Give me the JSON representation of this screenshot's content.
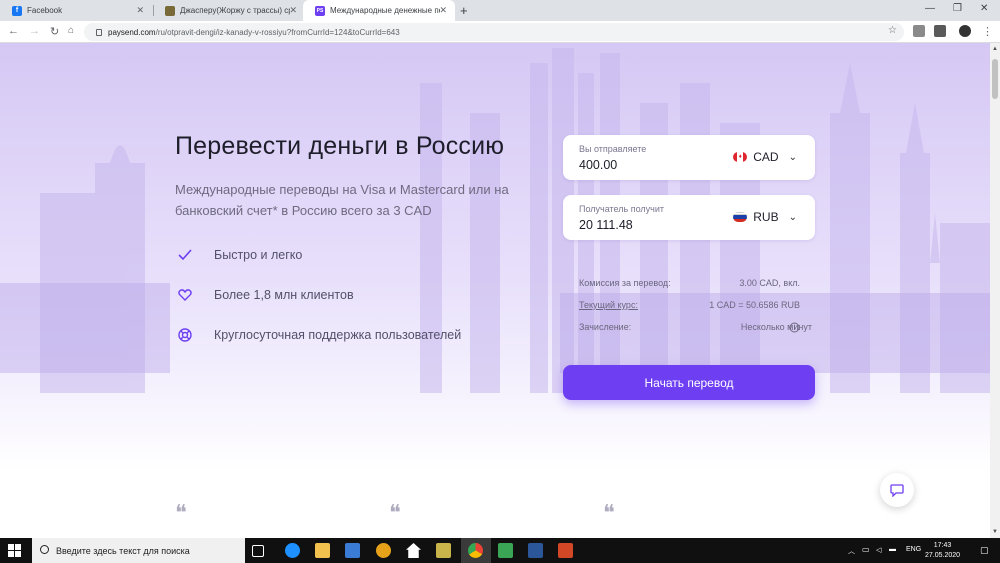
{
  "browser": {
    "tabs": [
      {
        "title": "Facebook",
        "favicon": "facebook-icon",
        "color": "#1877f2"
      },
      {
        "title": "Джасперу(Жоржу с трассы) сро",
        "favicon": "game-icon",
        "color": "#7a6a3a"
      },
      {
        "title": "Международные денежные пер",
        "favicon": "paysend-icon",
        "color": "#6e3ff2",
        "active": true
      }
    ],
    "url_domain": "paysend.com",
    "url_path": "/ru/otpravit-dengi/iz-kanady-v-rossiyu?fromCurrId=124&toCurrId=643"
  },
  "page": {
    "title": "Перевести деньги в Россию",
    "subtitle": "Международные переводы на Visa и Mastercard или на банковский счет* в Россию всего за 3 CAD",
    "features": [
      {
        "icon": "check-icon",
        "text": "Быстро и легко"
      },
      {
        "icon": "heart-icon",
        "text": "Более 1,8 млн клиентов"
      },
      {
        "icon": "lifebuoy-icon",
        "text": "Круглосуточная поддержка пользователей"
      }
    ],
    "accent": "#6e3ff2"
  },
  "calculator": {
    "send": {
      "label": "Вы отправляете",
      "value": "400.00",
      "currency": "CAD"
    },
    "receive": {
      "label": "Получатель получит",
      "value": "20 111.48",
      "currency": "RUB"
    },
    "fee_label": "Комиссия за перевод:",
    "fee_value": "3.00 CAD, вкл.",
    "rate_label": "Текущий курс:",
    "rate_value": "1 CAD = 50.6586 RUB",
    "credit_label": "Зачисление:",
    "credit_value": "Несколько минут",
    "cta": "Начать перевод"
  },
  "quote_mark": "❝",
  "taskbar": {
    "search_placeholder": "Введите здесь текст для поиска",
    "lang": "ENG",
    "time": "17:43",
    "date": "27.05.2020"
  }
}
